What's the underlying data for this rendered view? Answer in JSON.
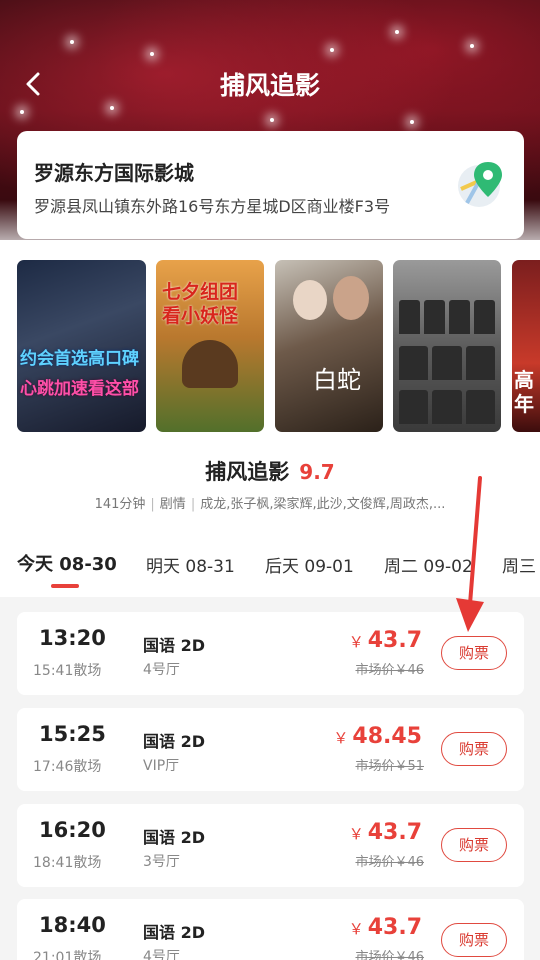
{
  "header": {
    "title": "捕风追影",
    "back_icon": "chevron-left-icon"
  },
  "cinema": {
    "name": "罗源东方国际影城",
    "address": "罗源县凤山镇东外路16号东方星城D区商业楼F3号",
    "map_icon": "map-pin-icon"
  },
  "posters": [
    {
      "text_lines": [
        "约会首选高口碑",
        "心跳加速看这部"
      ]
    },
    {
      "text_lines": [
        "七夕组团",
        "看小妖怪"
      ]
    },
    {
      "text_lines": [
        "白蛇"
      ]
    },
    {
      "text_lines": []
    },
    {
      "text_lines": [
        "高",
        "年"
      ]
    }
  ],
  "movie": {
    "title": "捕风追影",
    "score": "9.7",
    "duration": "141分钟",
    "genre": "剧情",
    "cast": "成龙,张子枫,梁家辉,此沙,文俊辉,周政杰,..."
  },
  "date_tabs": [
    {
      "label": "今天 08-30",
      "active": true
    },
    {
      "label": "明天 08-31",
      "active": false
    },
    {
      "label": "后天 09-01",
      "active": false
    },
    {
      "label": "周二 09-02",
      "active": false
    },
    {
      "label": "周三",
      "active": false
    }
  ],
  "showtimes": [
    {
      "start": "13:20",
      "end": "15:41散场",
      "lang": "国语 2D",
      "hall": "4号厅",
      "currency": "￥",
      "price": "43.7",
      "market": "市场价￥46",
      "buy_label": "购票"
    },
    {
      "start": "15:25",
      "end": "17:46散场",
      "lang": "国语 2D",
      "hall": "VIP厅",
      "currency": "￥",
      "price": "48.45",
      "market": "市场价￥51",
      "buy_label": "购票"
    },
    {
      "start": "16:20",
      "end": "18:41散场",
      "lang": "国语 2D",
      "hall": "3号厅",
      "currency": "￥",
      "price": "43.7",
      "market": "市场价￥46",
      "buy_label": "购票"
    },
    {
      "start": "18:40",
      "end": "21:01散场",
      "lang": "国语 2D",
      "hall": "4号厅",
      "currency": "￥",
      "price": "43.7",
      "market": "市场价￥46",
      "buy_label": "购票"
    }
  ],
  "colors": {
    "accent": "#e8413a",
    "header_bg": "#4a0d14"
  }
}
